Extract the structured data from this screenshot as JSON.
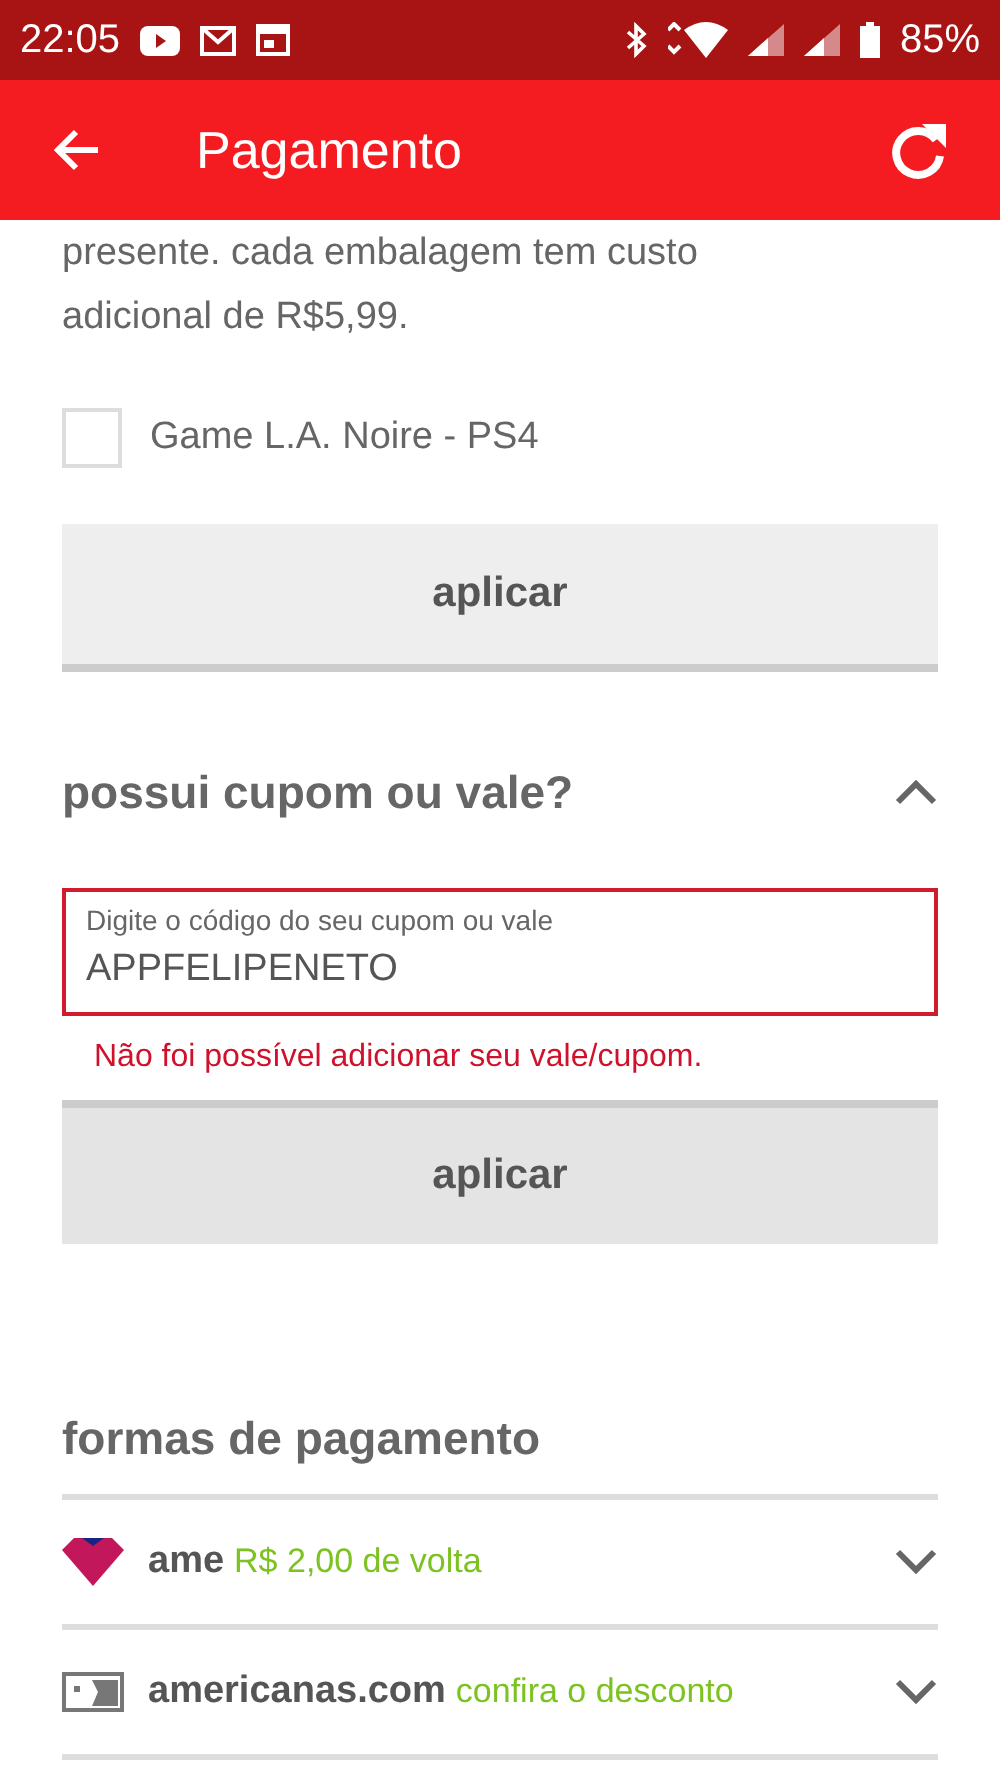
{
  "status_bar": {
    "time": "22:05",
    "battery": "85%"
  },
  "app_bar": {
    "title": "Pagamento"
  },
  "gift_note": {
    "lines": [
      "presente. cada embalagem tem custo",
      "adicional de R$5,99."
    ]
  },
  "gift_items": [
    {
      "label": "Game L.A. Noire - PS4",
      "checked": false
    }
  ],
  "gift_apply_button": "aplicar",
  "coupon": {
    "title": "possui cupom ou vale?",
    "expanded": true,
    "field": {
      "label": "Digite o código do seu cupom ou vale",
      "value": "APPFELIPENETO",
      "error": true
    },
    "error_message": "Não foi possível adicionar seu vale/cupom.",
    "apply_button": "aplicar"
  },
  "payment": {
    "title": "formas de pagamento",
    "methods": [
      {
        "kind": "ame",
        "name": "ame",
        "offer": "R$ 2,00 de volta",
        "expanded": false
      },
      {
        "kind": "card",
        "name": "americanas.com",
        "offer": "confira o desconto",
        "expanded": false
      }
    ]
  }
}
